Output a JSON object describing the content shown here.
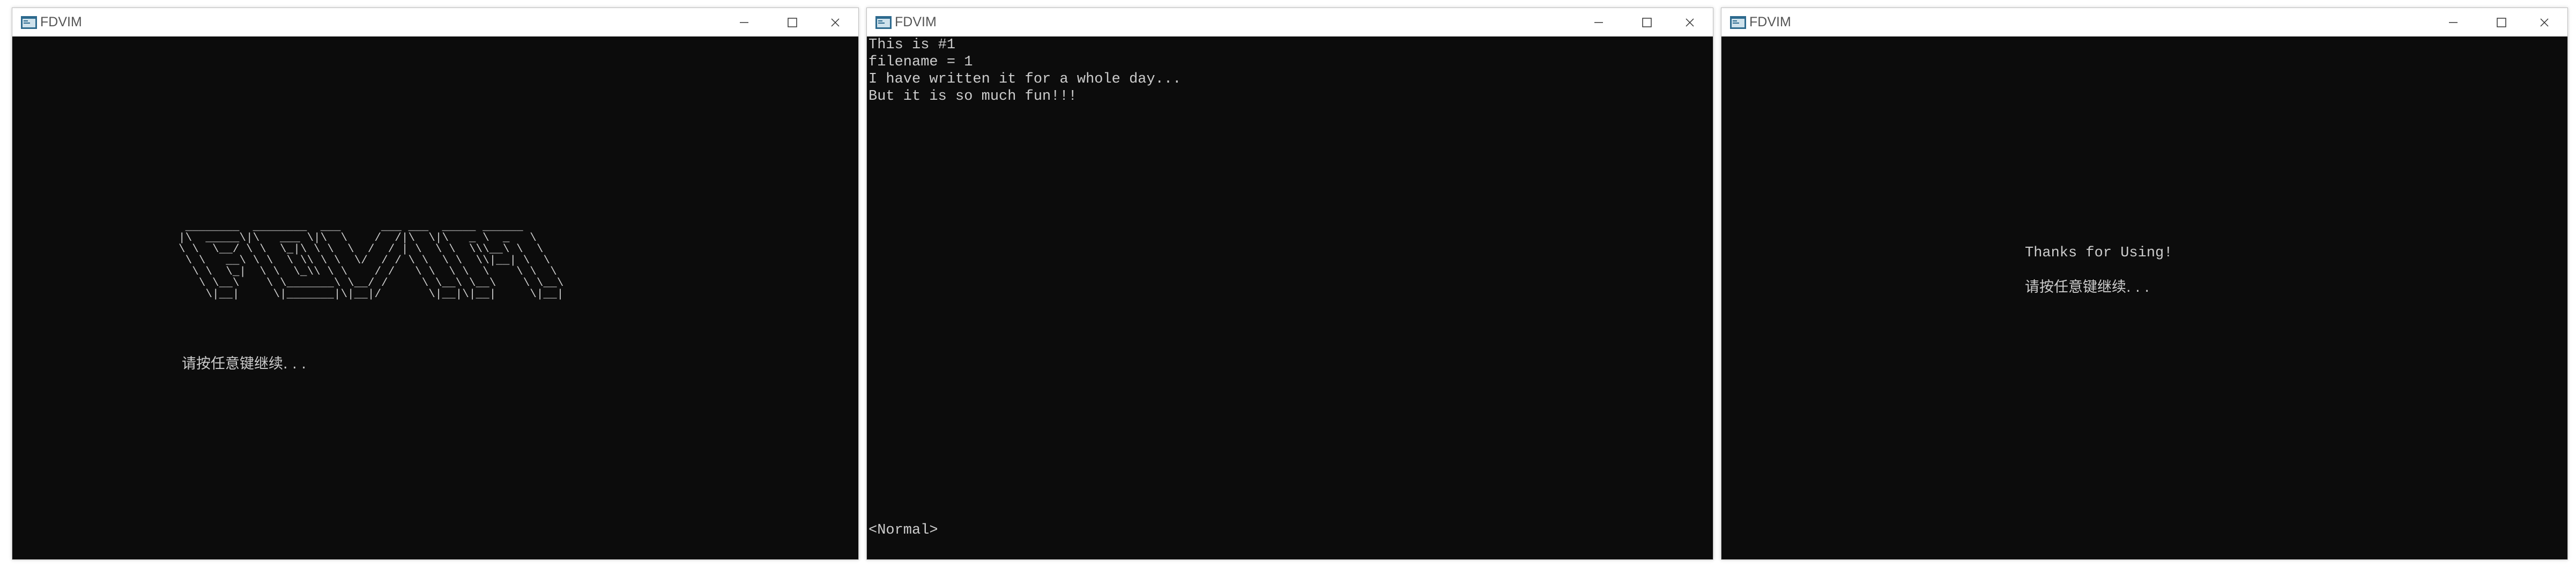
{
  "windows": [
    {
      "title": "FDVIM",
      "logo_text": "FDVIM",
      "prompt": "请按任意键继续. . ."
    },
    {
      "title": "FDVIM",
      "lines": [
        "This is #1",
        "filename = 1",
        "I have written it for a whole day...",
        "But it is so much fun!!!"
      ],
      "status": "<Normal>"
    },
    {
      "title": "FDVIM",
      "thanks": "Thanks for Using!",
      "prompt": "请按任意键继续. . ."
    }
  ],
  "icons": {
    "app": "console-app-icon",
    "minimize": "minimize-icon",
    "maximize": "maximize-icon",
    "close": "close-icon"
  },
  "colors": {
    "console_bg": "#0c0c0c",
    "console_fg": "#cccccc"
  }
}
